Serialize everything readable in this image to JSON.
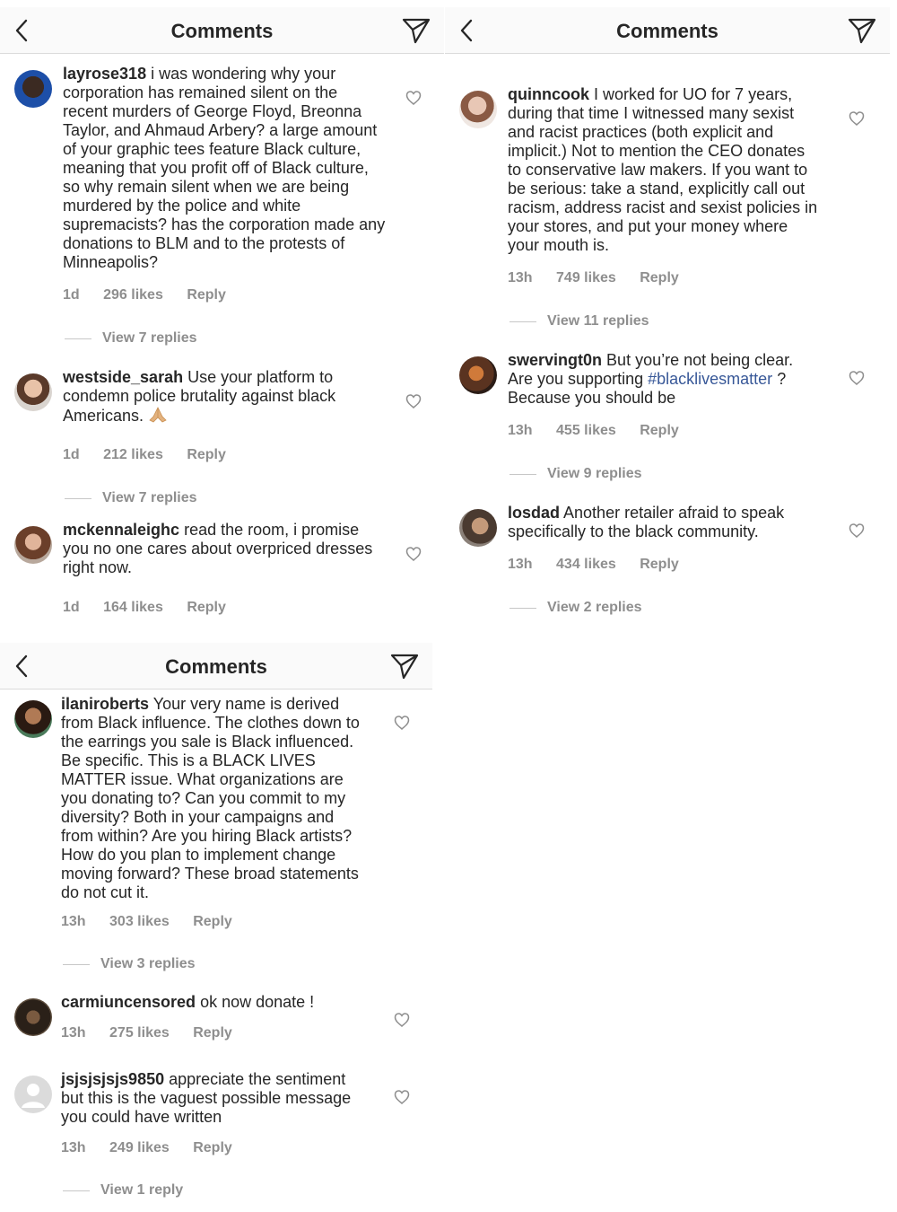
{
  "header": {
    "title": "Comments"
  },
  "actions": {
    "reply": "Reply"
  },
  "colors": {
    "hashtag": "#385898",
    "meta": "#8e8e8e",
    "text": "#262626"
  },
  "panels": [
    {
      "comments": [
        {
          "user": "layrose318",
          "text": "i was wondering why your corporation has remained silent on the recent murders of George Floyd, Breonna Taylor, and Ahmaud Arbery? a large amount of your graphic tees feature Black culture, meaning that you profit off of Black culture, so why remain silent when we are being murdered by the police and white supremacists? has the corporation made any donations to BLM and to the protests of Minneapolis?",
          "time": "1d",
          "likes": "296 likes",
          "replies": "View 7 replies"
        },
        {
          "user": "westside_sarah",
          "text": "Use your platform to condemn police brutality against black Americans.",
          "emoji": "folded-hands",
          "time": "1d",
          "likes": "212 likes",
          "replies": "View 7 replies"
        },
        {
          "user": "mckennaleighc",
          "text": "read the room, i promise you no one cares about overpriced dresses right now.",
          "time": "1d",
          "likes": "164 likes"
        }
      ]
    },
    {
      "comments": [
        {
          "user": "quinncook",
          "text": "I worked for UO for 7 years, during that time I witnessed many sexist and racist practices (both explicit and implicit.) Not to mention the CEO donates to conservative law makers. If you want to be serious: take a stand, explicitly call out racism, address racist and sexist policies in your stores, and put your money where your mouth is.",
          "time": "13h",
          "likes": "749 likes",
          "replies": "View 11 replies"
        },
        {
          "user": "swervingt0n",
          "text": "But you’re not being clear. Are you supporting",
          "hashtag": "#blacklivesmatter",
          "text_after": "? Because you should be",
          "time": "13h",
          "likes": "455 likes",
          "replies": "View 9 replies"
        },
        {
          "user": "losdad",
          "text": "Another retailer afraid to speak specifically to the black community.",
          "time": "13h",
          "likes": "434 likes",
          "replies": "View 2 replies"
        }
      ]
    },
    {
      "comments": [
        {
          "user": "ilaniroberts",
          "text": "Your very name is derived from Black influence. The clothes down to the earrings you sale is Black influenced. Be specific. This is a BLACK LIVES MATTER issue. What organizations are you donating to? Can you commit to my diversity? Both in your campaigns and from within? Are you hiring Black artists? How do you plan to implement change moving forward? These broad statements do not cut it.",
          "time": "13h",
          "likes": "303 likes",
          "replies": "View 3 replies"
        },
        {
          "user": "carmiuncensored",
          "text": "ok now donate !",
          "time": "13h",
          "likes": "275 likes"
        },
        {
          "user": "jsjsjsjsjs9850",
          "text": "appreciate the sentiment but this is the vaguest possible message you could have written",
          "time": "13h",
          "likes": "249 likes",
          "replies": "View 1 reply"
        }
      ]
    }
  ]
}
